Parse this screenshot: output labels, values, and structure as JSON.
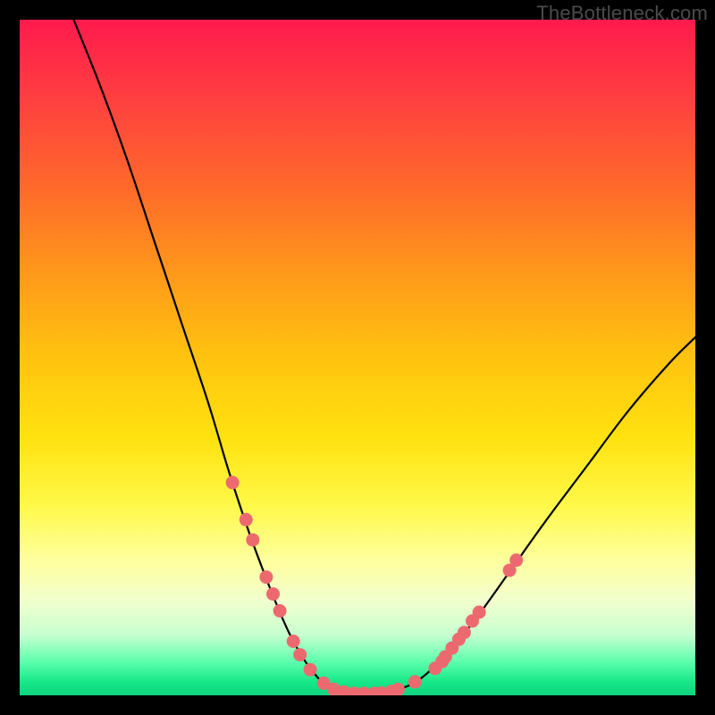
{
  "watermark": "TheBottleneck.com",
  "chart_data": {
    "type": "line",
    "title": "",
    "xlabel": "",
    "ylabel": "",
    "xlim": [
      0,
      100
    ],
    "ylim": [
      0,
      100
    ],
    "curve": {
      "left_branch": [
        {
          "x": 8,
          "y": 100
        },
        {
          "x": 12,
          "y": 90
        },
        {
          "x": 16,
          "y": 79
        },
        {
          "x": 20,
          "y": 67
        },
        {
          "x": 24,
          "y": 55
        },
        {
          "x": 28,
          "y": 43
        },
        {
          "x": 31,
          "y": 33
        },
        {
          "x": 34,
          "y": 24
        },
        {
          "x": 37,
          "y": 16
        },
        {
          "x": 40,
          "y": 9
        },
        {
          "x": 43,
          "y": 4
        },
        {
          "x": 46,
          "y": 1
        },
        {
          "x": 49,
          "y": 0.3
        }
      ],
      "right_branch": [
        {
          "x": 49,
          "y": 0.3
        },
        {
          "x": 53,
          "y": 0.3
        },
        {
          "x": 57,
          "y": 1.2
        },
        {
          "x": 60,
          "y": 3
        },
        {
          "x": 64,
          "y": 7
        },
        {
          "x": 68,
          "y": 12
        },
        {
          "x": 73,
          "y": 19
        },
        {
          "x": 78,
          "y": 26
        },
        {
          "x": 84,
          "y": 34
        },
        {
          "x": 90,
          "y": 42
        },
        {
          "x": 96,
          "y": 49
        },
        {
          "x": 100,
          "y": 53
        }
      ]
    },
    "markers_left": [
      {
        "x": 31.5,
        "y": 31.5
      },
      {
        "x": 33.5,
        "y": 26.0
      },
      {
        "x": 34.5,
        "y": 23.0
      },
      {
        "x": 36.5,
        "y": 17.5
      },
      {
        "x": 37.5,
        "y": 15.0
      },
      {
        "x": 38.5,
        "y": 12.5
      },
      {
        "x": 40.5,
        "y": 8.0
      },
      {
        "x": 41.5,
        "y": 6.0
      },
      {
        "x": 43.0,
        "y": 3.8
      },
      {
        "x": 45.0,
        "y": 1.8
      }
    ],
    "markers_bottom": [
      {
        "x": 46.5,
        "y": 0.9
      },
      {
        "x": 48.0,
        "y": 0.5
      },
      {
        "x": 49.5,
        "y": 0.3
      },
      {
        "x": 51.0,
        "y": 0.3
      },
      {
        "x": 52.5,
        "y": 0.3
      },
      {
        "x": 53.5,
        "y": 0.35
      },
      {
        "x": 55.0,
        "y": 0.6
      },
      {
        "x": 56.0,
        "y": 0.9
      }
    ],
    "markers_right": [
      {
        "x": 58.5,
        "y": 2.0
      },
      {
        "x": 61.5,
        "y": 4.0
      },
      {
        "x": 62.5,
        "y": 5.0
      },
      {
        "x": 63.0,
        "y": 5.7
      },
      {
        "x": 64.0,
        "y": 7.0
      },
      {
        "x": 65.0,
        "y": 8.3
      },
      {
        "x": 65.8,
        "y": 9.3
      },
      {
        "x": 67.0,
        "y": 11.0
      },
      {
        "x": 68.0,
        "y": 12.3
      },
      {
        "x": 72.5,
        "y": 18.5
      },
      {
        "x": 73.5,
        "y": 20.0
      }
    ],
    "marker_color": "#ec6a6f",
    "curve_color": "#000000"
  }
}
